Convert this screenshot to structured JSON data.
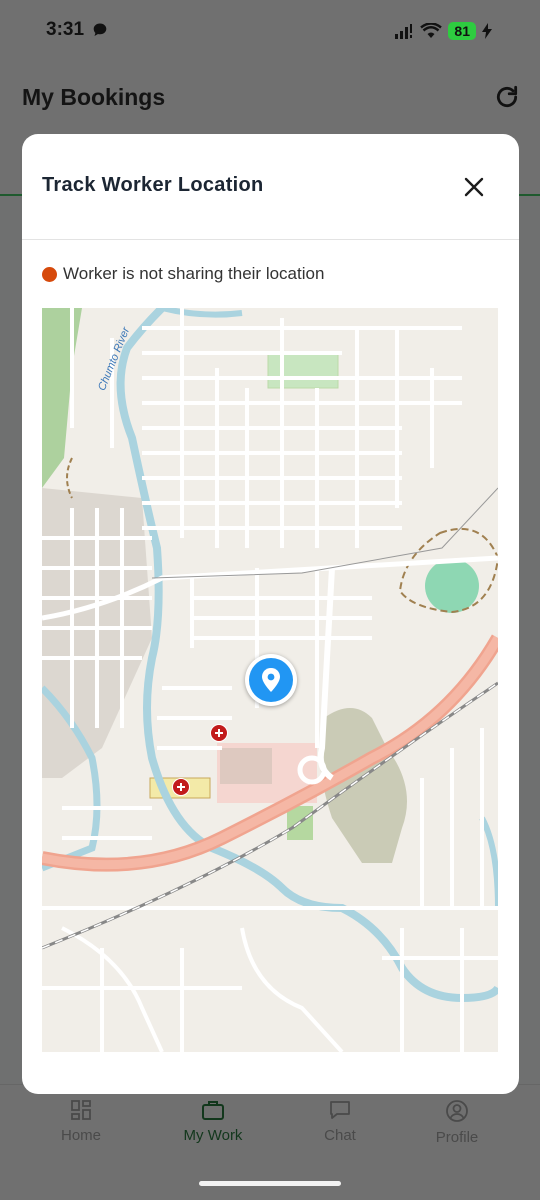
{
  "status_bar": {
    "time": "3:31",
    "battery": "81"
  },
  "header": {
    "title": "My Bookings"
  },
  "modal": {
    "title": "Track Worker Location",
    "status_text": "Worker is not sharing their location",
    "status_color": "#d64a0c"
  },
  "map": {
    "river_label": "Chumto River",
    "pin_color": "#2196f3"
  },
  "bottom_nav": {
    "items": [
      {
        "label": "Home",
        "icon": "grid-icon"
      },
      {
        "label": "My Work",
        "icon": "briefcase-icon",
        "active": true
      },
      {
        "label": "Chat",
        "icon": "chat-bubble-icon"
      },
      {
        "label": "Profile",
        "icon": "profile-icon"
      }
    ]
  }
}
